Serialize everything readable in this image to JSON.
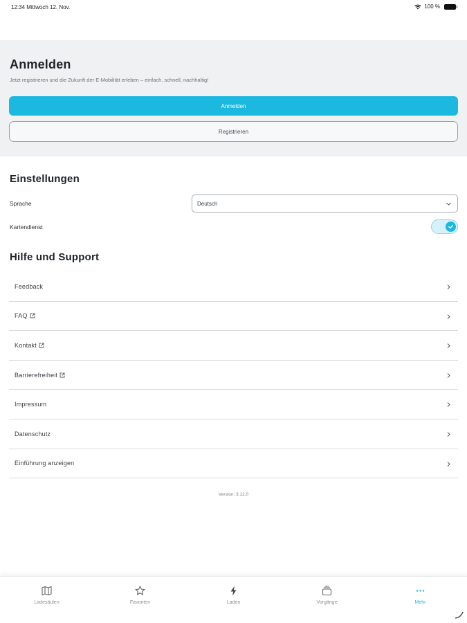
{
  "status_bar": {
    "time_date": "12:34  Mittwoch 12. Nov.",
    "battery": "100 %"
  },
  "login": {
    "title": "Anmelden",
    "subtitle": "Jetzt registrieren und die Zukunft der E-Mobilität erleben – einfach, schnell, nachhaltig!",
    "login_button": "Anmelden",
    "register_button": "Registrieren"
  },
  "settings": {
    "title": "Einstellungen",
    "language_label": "Sprache",
    "language_value": "Deutsch",
    "map_service_label": "Kartendienst",
    "map_service_enabled": true
  },
  "help": {
    "title": "Hilfe und Support",
    "items": [
      {
        "label": "Feedback",
        "external": false
      },
      {
        "label": "FAQ",
        "external": true
      },
      {
        "label": "Kontakt",
        "external": true
      },
      {
        "label": "Barrierefreiheit",
        "external": true
      },
      {
        "label": "Impressum",
        "external": false
      },
      {
        "label": "Datenschutz",
        "external": false
      },
      {
        "label": "Einführung anzeigen",
        "external": false
      }
    ]
  },
  "version": "Version: 3.12.0",
  "tabbar": {
    "tabs": [
      {
        "label": "Ladesäulen",
        "icon": "map-icon",
        "active": false
      },
      {
        "label": "Favoriten",
        "icon": "star-icon",
        "active": false
      },
      {
        "label": "Laden",
        "icon": "bolt-icon",
        "active": false
      },
      {
        "label": "Vorgänge",
        "icon": "stack-icon",
        "active": false
      },
      {
        "label": "Mehr",
        "icon": "more-icon",
        "active": true
      }
    ]
  },
  "colors": {
    "accent": "#1bb8e0",
    "panel_bg": "#f0f1f3",
    "divider": "#d9dcdf"
  }
}
